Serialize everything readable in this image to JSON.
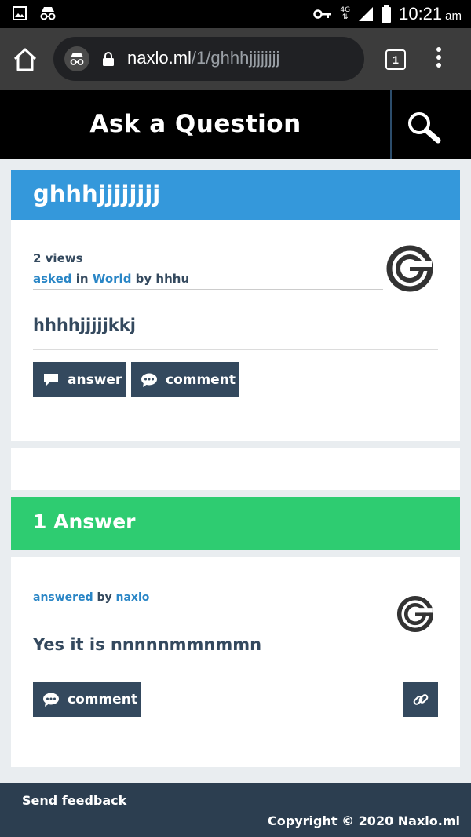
{
  "status_bar": {
    "network": "4G",
    "time": "10:21",
    "ampm": "am"
  },
  "browser": {
    "url_domain": "naxlo.ml",
    "url_path": "/1/ghhhjjjjjjjj",
    "tab_count": "1"
  },
  "header": {
    "ask_label": "Ask a Question"
  },
  "question": {
    "title": "ghhhjjjjjjjj",
    "views": "2 views",
    "asked_label": "asked",
    "in_label": "in",
    "category": "World",
    "by_label": "by",
    "author": "hhhu",
    "body": "hhhhjjjjjkkj",
    "answer_button": "answer",
    "comment_button": "comment"
  },
  "answers": {
    "heading": "1 Answer",
    "items": [
      {
        "answered_label": "answered",
        "by_label": "by",
        "author": "naxlo",
        "body": "Yes it is nnnnnmmnmmn",
        "comment_button": "comment"
      }
    ]
  },
  "footer": {
    "feedback": "Send feedback",
    "copyright": "Copyright © 2020 Naxlo.ml"
  },
  "colors": {
    "question_bar": "#3498db",
    "answer_bar": "#2ecc71",
    "button": "#34495e",
    "link": "#2a86c6",
    "footer": "#2c3e50"
  }
}
